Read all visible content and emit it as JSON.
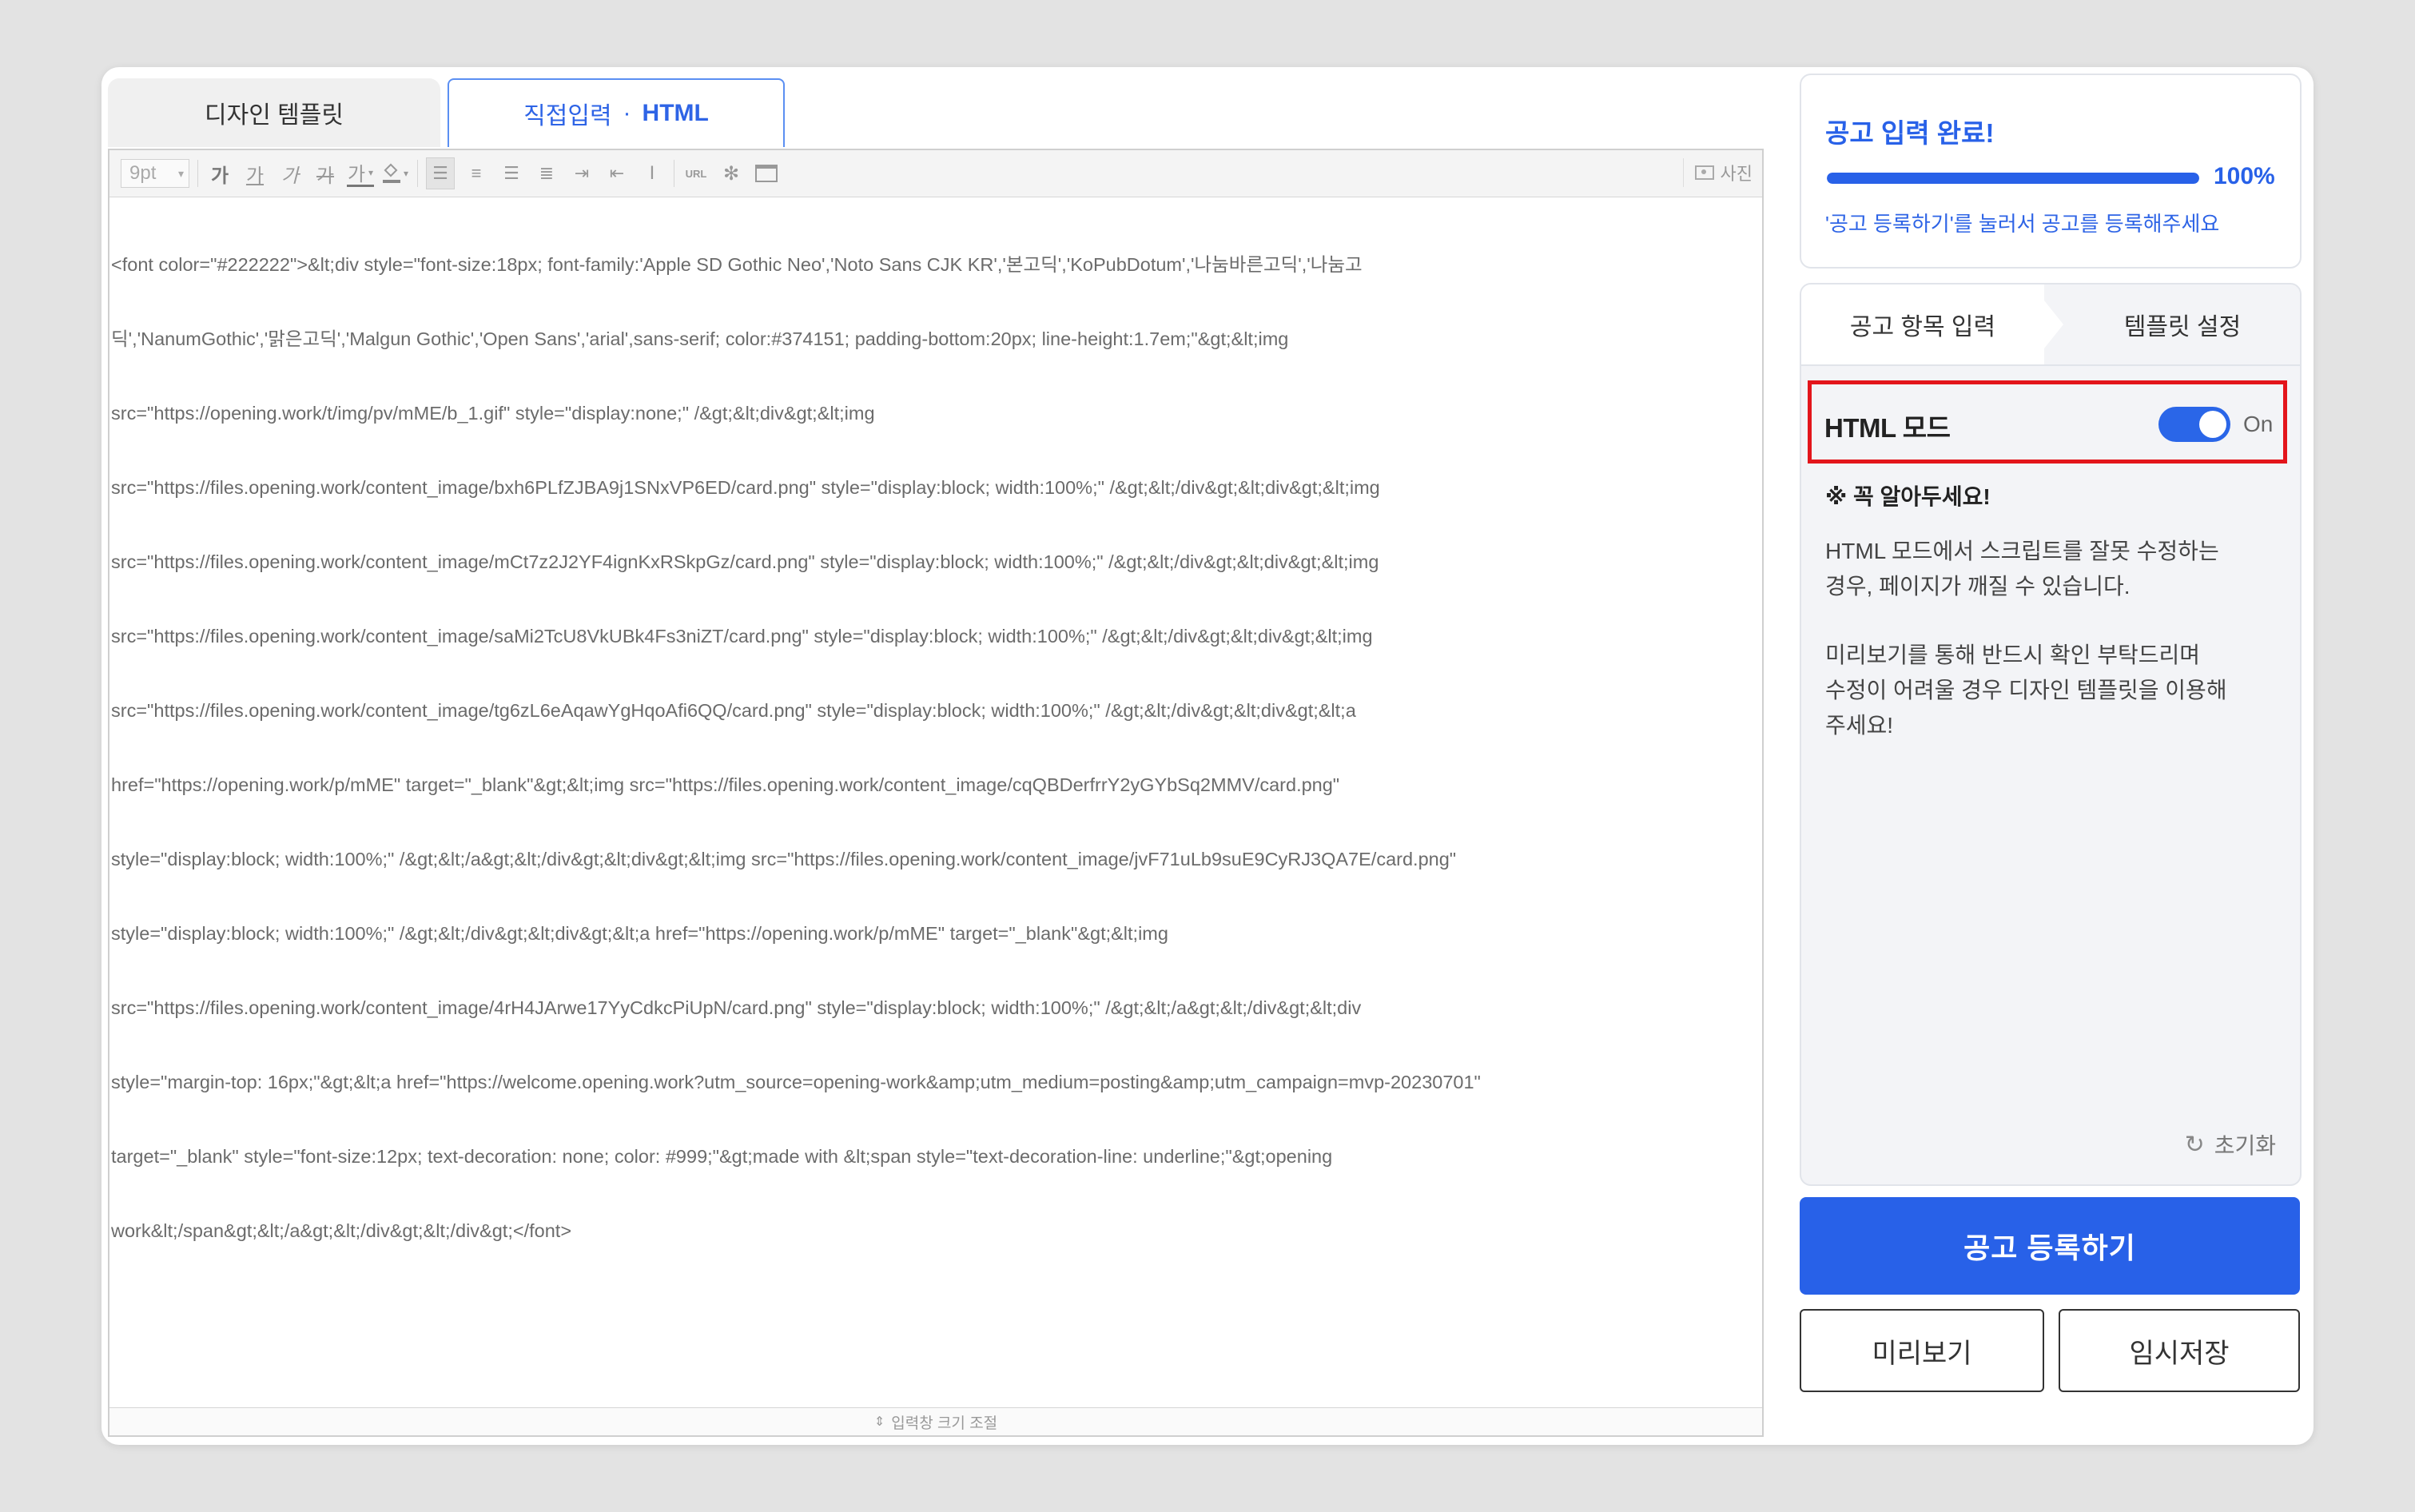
{
  "editor": {
    "tabs": {
      "design_template": "디자인 템플릿",
      "direct_input": "직접입력",
      "separator": "·",
      "html": "HTML"
    },
    "toolbar": {
      "font_size": "9pt",
      "bold": "가",
      "underline": "가",
      "italic": "가",
      "strike": "가",
      "text_color": "가",
      "background_color": "가",
      "photo": "사진",
      "url": "URL"
    },
    "code_lines": [
      "<font color=\"#222222\">&lt;div style=\"font-size:18px; font-family:'Apple SD Gothic Neo','Noto Sans CJK KR','본고딕','KoPubDotum','나눔바른고딕','나눔고",
      "딕','NanumGothic','맑은고딕','Malgun Gothic','Open Sans','arial',sans-serif; color:#374151; padding-bottom:20px; line-height:1.7em;\"&gt;&lt;img",
      "src=\"https://opening.work/t/img/pv/mME/b_1.gif\" style=\"display:none;\" /&gt;&lt;div&gt;&lt;img",
      "src=\"https://files.opening.work/content_image/bxh6PLfZJBA9j1SNxVP6ED/card.png\" style=\"display:block; width:100%;\" /&gt;&lt;/div&gt;&lt;div&gt;&lt;img",
      "src=\"https://files.opening.work/content_image/mCt7z2J2YF4ignKxRSkpGz/card.png\" style=\"display:block; width:100%;\" /&gt;&lt;/div&gt;&lt;div&gt;&lt;img",
      "src=\"https://files.opening.work/content_image/saMi2TcU8VkUBk4Fs3niZT/card.png\" style=\"display:block; width:100%;\" /&gt;&lt;/div&gt;&lt;div&gt;&lt;img",
      "src=\"https://files.opening.work/content_image/tg6zL6eAqawYgHqoAfi6QQ/card.png\" style=\"display:block; width:100%;\" /&gt;&lt;/div&gt;&lt;div&gt;&lt;a",
      "href=\"https://opening.work/p/mME\" target=\"_blank\"&gt;&lt;img src=\"https://files.opening.work/content_image/cqQBDerfrrY2yGYbSq2MMV/card.png\"",
      "style=\"display:block; width:100%;\" /&gt;&lt;/a&gt;&lt;/div&gt;&lt;div&gt;&lt;img src=\"https://files.opening.work/content_image/jvF71uLb9suE9CyRJ3QA7E/card.png\"",
      "style=\"display:block; width:100%;\" /&gt;&lt;/div&gt;&lt;div&gt;&lt;a href=\"https://opening.work/p/mME\" target=\"_blank\"&gt;&lt;img",
      "src=\"https://files.opening.work/content_image/4rH4JArwe17YyCdkcPiUpN/card.png\" style=\"display:block; width:100%;\" /&gt;&lt;/a&gt;&lt;/div&gt;&lt;div",
      "style=\"margin-top: 16px;\"&gt;&lt;a href=\"https://welcome.opening.work?utm_source=opening-work&amp;utm_medium=posting&amp;utm_campaign=mvp-20230701\"",
      "target=\"_blank\" style=\"font-size:12px; text-decoration: none; color: #999;\"&gt;made with &lt;span style=\"text-decoration-line: underline;\"&gt;opening",
      "work&lt;/span&gt;&lt;/a&gt;&lt;/div&gt;&lt;/div&gt;</font>"
    ],
    "resize_label": "입력창 크기 조절"
  },
  "status": {
    "title": "공고 입력 완료!",
    "progress_percent": 100,
    "progress_label": "100%",
    "help_text": "'공고 등록하기'를 눌러서 공고를 등록해주세요"
  },
  "settings": {
    "tabs": [
      "공고 항목 입력",
      "템플릿 설정"
    ],
    "html_mode_label": "HTML 모드",
    "toggle_state": "On",
    "notice_title": "※ 꼭 알아두세요!",
    "notice_p1_lines": [
      "HTML 모드에서 스크립트를 잘못 수정하는",
      "경우, 페이지가 깨질 수 있습니다."
    ],
    "notice_p2_lines": [
      "미리보기를 통해 반드시 확인 부탁드리며",
      "수정이 어려울 경우 디자인 템플릿을 이용해",
      "주세요!"
    ],
    "reset_label": "초기화"
  },
  "actions": {
    "register": "공고 등록하기",
    "preview": "미리보기",
    "temp_save": "임시저장"
  },
  "colors": {
    "accent": "#2861e8",
    "highlight_border": "#e3151b",
    "background": "#e3e3e3"
  }
}
